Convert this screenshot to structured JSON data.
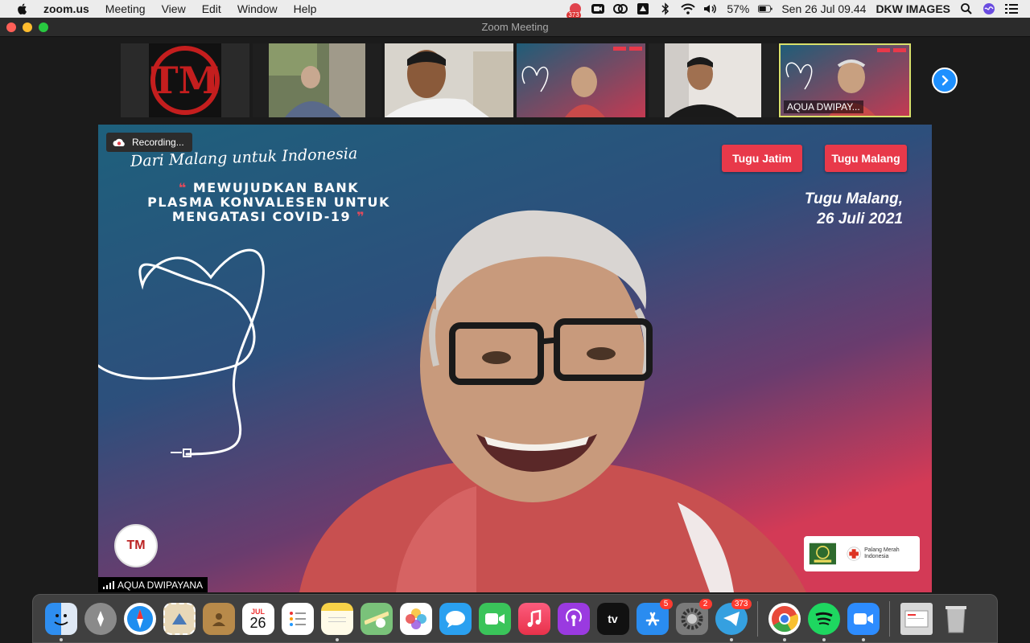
{
  "menubar": {
    "app_name": "zoom.us",
    "items": [
      "Meeting",
      "View",
      "Edit",
      "Window",
      "Help"
    ],
    "status": {
      "notif_badge": "373",
      "battery_percent": "57%",
      "datetime": "Sen 26 Jul  09.44",
      "user": "DKW IMAGES"
    }
  },
  "window": {
    "title": "Zoom Meeting"
  },
  "thumbnails": {
    "active_label": "AQUA DWIPAY..."
  },
  "main_video": {
    "recording_label": "Recording...",
    "speaker_name": "AQUA DWIPAYANA",
    "tagline": "Dari Malang untuk Indonesia",
    "headline_1": "MEWUJUDKAN BANK",
    "headline_2": "PLASMA KONVALESEN UNTUK",
    "headline_3": "MENGATASI COVID-19",
    "brand_1": "Tugu Jatim",
    "brand_2": "Tugu Malang",
    "place": "Tugu Malang,",
    "date": "26 Juli 2021",
    "logo_text": "TM",
    "pmi_text": "Palang Merah Indonesia"
  },
  "dock": {
    "calendar_month": "JUL",
    "calendar_day": "26",
    "appstore_badge": "5",
    "settings_badge": "2",
    "telegram_badge": "373",
    "appletv_label": "tv"
  },
  "colors": {
    "accent_blue": "#1e90ff",
    "brand_red": "#e8394a",
    "active_border": "#d9e06b"
  }
}
